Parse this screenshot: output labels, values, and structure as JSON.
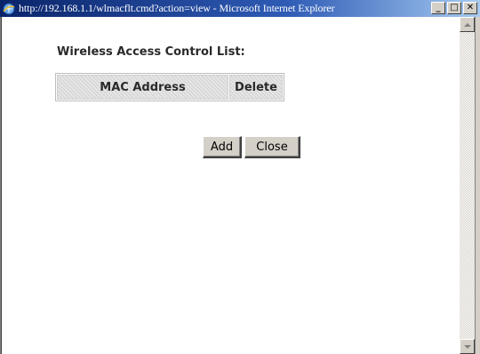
{
  "window": {
    "title": "http://192.168.1.1/wlmacflt.cmd?action=view - Microsoft Internet Explorer",
    "controls": {
      "minimize": "_",
      "maximize": "□",
      "close": "✕"
    },
    "icon": "ie-icon"
  },
  "page": {
    "heading": "Wireless Access Control List:",
    "table": {
      "columns": [
        "MAC Address",
        "Delete"
      ],
      "rows": []
    },
    "buttons": {
      "add": "Add",
      "close": "Close"
    }
  },
  "colors": {
    "titlebar_start": "#0a246a",
    "titlebar_end": "#a6caf0",
    "button_face": "#d4d0c8"
  }
}
